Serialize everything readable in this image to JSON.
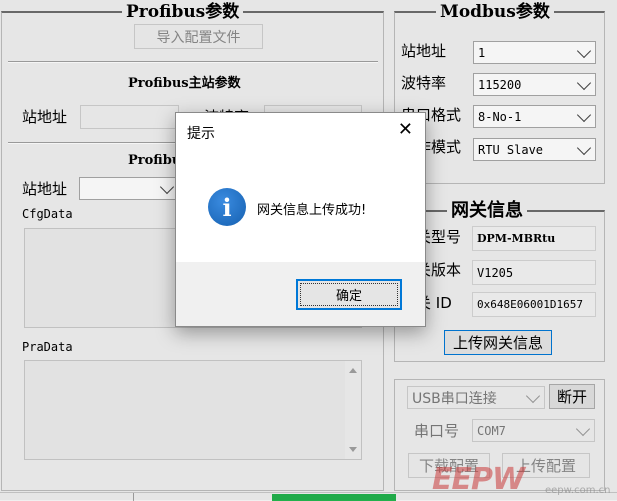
{
  "profibus": {
    "group_title": "Profibus参数",
    "import_button": "导入配置文件",
    "master_title": "Profibus主站参数",
    "master_station_label": "站地址",
    "master_baud_label": "波特率",
    "slave_title": "Profibus从站参数",
    "slave_station_label": "站地址",
    "cfg_label": "CfgData",
    "pra_label": "PraData"
  },
  "modbus": {
    "group_title": "Modbus参数",
    "station_label": "站地址",
    "station_value": "1",
    "baud_label": "波特率",
    "baud_value": "115200",
    "serial_label": "串口格式",
    "serial_value": "8-No-1",
    "mode_label": "工作模式",
    "mode_value": "RTU Slave"
  },
  "gateway": {
    "group_title": "网关信息",
    "model_label": "网关型号",
    "model_value": "DPM-MBRtu",
    "version_label": "网关版本",
    "version_value": "V1205",
    "id_label": "网关 ID",
    "id_value": "0x648E06001D1657",
    "upload_button": "上传网关信息"
  },
  "connection": {
    "mode_value": "USB串口连接",
    "disconnect_button": "断开",
    "port_label": "串口号",
    "port_value": "COM7",
    "download_button": "下载配置",
    "upload_button": "上传配置"
  },
  "dialog": {
    "title": "提示",
    "close_glyph": "✕",
    "icon_glyph": "i",
    "message": "网关信息上传成功!",
    "ok_button": "确定"
  },
  "watermark": {
    "logo": "EEPW",
    "domain": "eepw.com.cn"
  },
  "colors": {
    "accent": "#0078d7",
    "info_icon": "#1f6fc0",
    "progress": "#22b14c"
  }
}
